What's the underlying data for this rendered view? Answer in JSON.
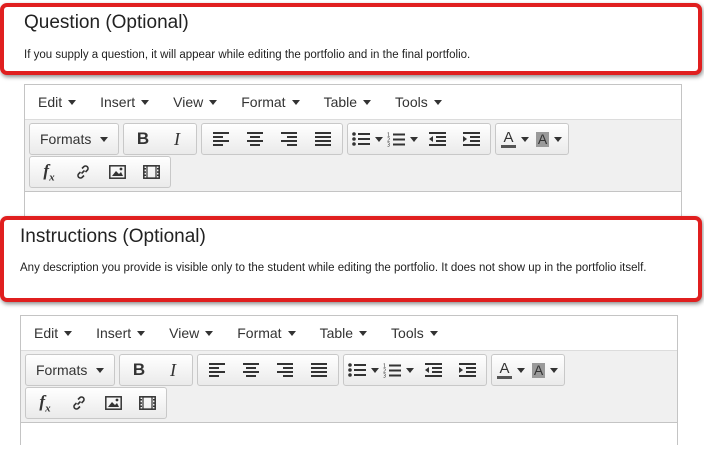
{
  "question": {
    "title": "Question (Optional)",
    "description": "If you supply a question, it will appear while editing the portfolio and in the final portfolio."
  },
  "instructions": {
    "title": "Instructions (Optional)",
    "description": "Any description you provide is visible only to the student while editing the portfolio. It does not show up in the portfolio itself."
  },
  "menu": {
    "edit": "Edit",
    "insert": "Insert",
    "view": "View",
    "format": "Format",
    "table": "Table",
    "tools": "Tools"
  },
  "toolbar": {
    "formats": "Formats",
    "bold": "B",
    "italic": "I",
    "text_color": "A",
    "bg_color": "A",
    "fx": "f"
  },
  "colors": {
    "callout_border": "#e01f1f",
    "toolbar_bg": "#f0f0f0",
    "editor_border": "#c4c4c4"
  }
}
